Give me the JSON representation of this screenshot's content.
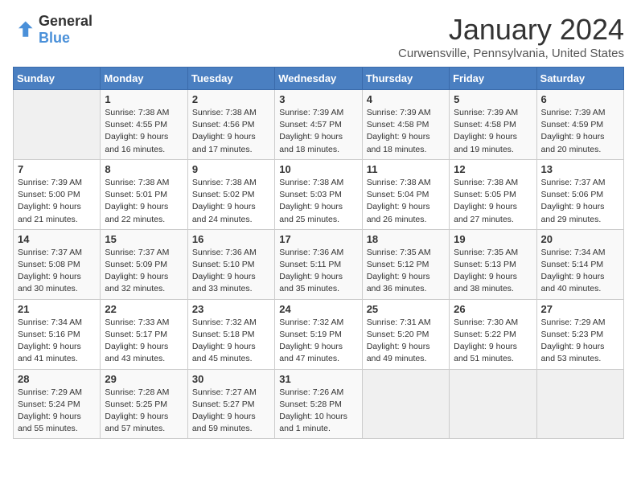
{
  "header": {
    "logo_general": "General",
    "logo_blue": "Blue",
    "month_title": "January 2024",
    "location": "Curwensville, Pennsylvania, United States"
  },
  "calendar": {
    "days_of_week": [
      "Sunday",
      "Monday",
      "Tuesday",
      "Wednesday",
      "Thursday",
      "Friday",
      "Saturday"
    ],
    "weeks": [
      [
        {
          "day": "",
          "info": ""
        },
        {
          "day": "1",
          "info": "Sunrise: 7:38 AM\nSunset: 4:55 PM\nDaylight: 9 hours\nand 16 minutes."
        },
        {
          "day": "2",
          "info": "Sunrise: 7:38 AM\nSunset: 4:56 PM\nDaylight: 9 hours\nand 17 minutes."
        },
        {
          "day": "3",
          "info": "Sunrise: 7:39 AM\nSunset: 4:57 PM\nDaylight: 9 hours\nand 18 minutes."
        },
        {
          "day": "4",
          "info": "Sunrise: 7:39 AM\nSunset: 4:58 PM\nDaylight: 9 hours\nand 18 minutes."
        },
        {
          "day": "5",
          "info": "Sunrise: 7:39 AM\nSunset: 4:58 PM\nDaylight: 9 hours\nand 19 minutes."
        },
        {
          "day": "6",
          "info": "Sunrise: 7:39 AM\nSunset: 4:59 PM\nDaylight: 9 hours\nand 20 minutes."
        }
      ],
      [
        {
          "day": "7",
          "info": "Sunrise: 7:39 AM\nSunset: 5:00 PM\nDaylight: 9 hours\nand 21 minutes."
        },
        {
          "day": "8",
          "info": "Sunrise: 7:38 AM\nSunset: 5:01 PM\nDaylight: 9 hours\nand 22 minutes."
        },
        {
          "day": "9",
          "info": "Sunrise: 7:38 AM\nSunset: 5:02 PM\nDaylight: 9 hours\nand 24 minutes."
        },
        {
          "day": "10",
          "info": "Sunrise: 7:38 AM\nSunset: 5:03 PM\nDaylight: 9 hours\nand 25 minutes."
        },
        {
          "day": "11",
          "info": "Sunrise: 7:38 AM\nSunset: 5:04 PM\nDaylight: 9 hours\nand 26 minutes."
        },
        {
          "day": "12",
          "info": "Sunrise: 7:38 AM\nSunset: 5:05 PM\nDaylight: 9 hours\nand 27 minutes."
        },
        {
          "day": "13",
          "info": "Sunrise: 7:37 AM\nSunset: 5:06 PM\nDaylight: 9 hours\nand 29 minutes."
        }
      ],
      [
        {
          "day": "14",
          "info": "Sunrise: 7:37 AM\nSunset: 5:08 PM\nDaylight: 9 hours\nand 30 minutes."
        },
        {
          "day": "15",
          "info": "Sunrise: 7:37 AM\nSunset: 5:09 PM\nDaylight: 9 hours\nand 32 minutes."
        },
        {
          "day": "16",
          "info": "Sunrise: 7:36 AM\nSunset: 5:10 PM\nDaylight: 9 hours\nand 33 minutes."
        },
        {
          "day": "17",
          "info": "Sunrise: 7:36 AM\nSunset: 5:11 PM\nDaylight: 9 hours\nand 35 minutes."
        },
        {
          "day": "18",
          "info": "Sunrise: 7:35 AM\nSunset: 5:12 PM\nDaylight: 9 hours\nand 36 minutes."
        },
        {
          "day": "19",
          "info": "Sunrise: 7:35 AM\nSunset: 5:13 PM\nDaylight: 9 hours\nand 38 minutes."
        },
        {
          "day": "20",
          "info": "Sunrise: 7:34 AM\nSunset: 5:14 PM\nDaylight: 9 hours\nand 40 minutes."
        }
      ],
      [
        {
          "day": "21",
          "info": "Sunrise: 7:34 AM\nSunset: 5:16 PM\nDaylight: 9 hours\nand 41 minutes."
        },
        {
          "day": "22",
          "info": "Sunrise: 7:33 AM\nSunset: 5:17 PM\nDaylight: 9 hours\nand 43 minutes."
        },
        {
          "day": "23",
          "info": "Sunrise: 7:32 AM\nSunset: 5:18 PM\nDaylight: 9 hours\nand 45 minutes."
        },
        {
          "day": "24",
          "info": "Sunrise: 7:32 AM\nSunset: 5:19 PM\nDaylight: 9 hours\nand 47 minutes."
        },
        {
          "day": "25",
          "info": "Sunrise: 7:31 AM\nSunset: 5:20 PM\nDaylight: 9 hours\nand 49 minutes."
        },
        {
          "day": "26",
          "info": "Sunrise: 7:30 AM\nSunset: 5:22 PM\nDaylight: 9 hours\nand 51 minutes."
        },
        {
          "day": "27",
          "info": "Sunrise: 7:29 AM\nSunset: 5:23 PM\nDaylight: 9 hours\nand 53 minutes."
        }
      ],
      [
        {
          "day": "28",
          "info": "Sunrise: 7:29 AM\nSunset: 5:24 PM\nDaylight: 9 hours\nand 55 minutes."
        },
        {
          "day": "29",
          "info": "Sunrise: 7:28 AM\nSunset: 5:25 PM\nDaylight: 9 hours\nand 57 minutes."
        },
        {
          "day": "30",
          "info": "Sunrise: 7:27 AM\nSunset: 5:27 PM\nDaylight: 9 hours\nand 59 minutes."
        },
        {
          "day": "31",
          "info": "Sunrise: 7:26 AM\nSunset: 5:28 PM\nDaylight: 10 hours\nand 1 minute."
        },
        {
          "day": "",
          "info": ""
        },
        {
          "day": "",
          "info": ""
        },
        {
          "day": "",
          "info": ""
        }
      ]
    ]
  }
}
